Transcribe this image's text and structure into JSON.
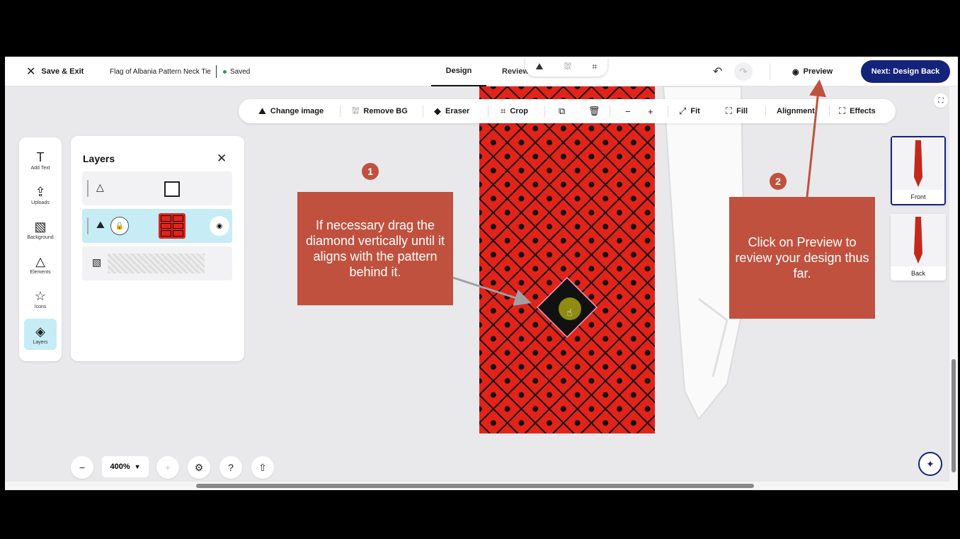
{
  "topbar": {
    "save_exit": "Save & Exit",
    "doc_title": "Flag of Albania Pattern Neck Tie",
    "saved": "Saved",
    "tab_design": "Design",
    "tab_review": "Review",
    "preview": "Preview",
    "next": "Next: Design Back"
  },
  "toolbar": {
    "change_image": "Change image",
    "remove_bg": "Remove BG",
    "eraser": "Eraser",
    "crop": "Crop",
    "fit": "Fit",
    "fill": "Fill",
    "alignment": "Alignment",
    "effects": "Effects"
  },
  "rail": {
    "items": [
      {
        "label": "Add Text",
        "icon": "text-icon"
      },
      {
        "label": "Uploads",
        "icon": "upload-icon"
      },
      {
        "label": "Background",
        "icon": "background-icon"
      },
      {
        "label": "Elements",
        "icon": "elements-icon"
      },
      {
        "label": "Icons",
        "icon": "star-icon"
      },
      {
        "label": "Layers",
        "icon": "layers-icon"
      }
    ]
  },
  "layers": {
    "title": "Layers"
  },
  "views": {
    "front": "Front",
    "back": "Back"
  },
  "zoom": {
    "value": "400%"
  },
  "annotations": {
    "badge1": "1",
    "callout1": "If necessary drag the diamond vertically until it aligns with the pattern behind it.",
    "badge2": "2",
    "callout2": "Click on Preview to review your design thus far."
  },
  "colors": {
    "accent": "#15237a",
    "callout": "#c0513e",
    "tie_red": "#e2231a",
    "selected_layer": "#c6ecf6"
  }
}
